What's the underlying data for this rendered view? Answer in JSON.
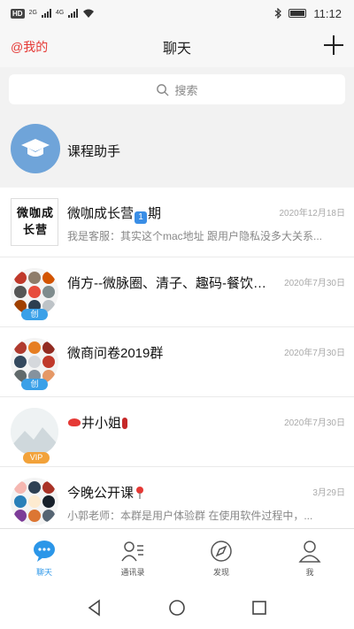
{
  "status_bar": {
    "hd": "HD",
    "net1": "2G",
    "net2": "4G",
    "time": "11:12"
  },
  "header": {
    "me": "@我的",
    "title": "聊天"
  },
  "search": {
    "placeholder": "搜索"
  },
  "chats": [
    {
      "name": "课程助手",
      "time": "",
      "preview": ""
    },
    {
      "name": "微咖成长营",
      "name_suffix": "期",
      "time": "2020年12月18日",
      "preview": "我是客服：其实这个mac地址 跟用户隐私没多大关系...",
      "logo_text": "微咖成长营"
    },
    {
      "name": "俏方--微脉圈、清子、趣码-餐饮终...",
      "time": "2020年7月30日",
      "preview": "",
      "badge": "创"
    },
    {
      "name": "微商问卷2019群",
      "time": "2020年7月30日",
      "preview": "",
      "badge": "创"
    },
    {
      "name": "井小姐",
      "time": "2020年7月30日",
      "preview": "",
      "badge": "VIP"
    },
    {
      "name": "今晚公开课",
      "time": "3月29日",
      "preview": "小郭老师：本群是用户体验群 在使用软件过程中，..."
    }
  ],
  "tabs": [
    {
      "label": "聊天",
      "icon": "chat-icon"
    },
    {
      "label": "通讯录",
      "icon": "contacts-icon"
    },
    {
      "label": "发现",
      "icon": "discover-icon"
    },
    {
      "label": "我",
      "icon": "user-icon"
    }
  ],
  "colors": {
    "accent": "#2b96e8",
    "me_red": "#e53935",
    "vip": "#f2a23a"
  }
}
